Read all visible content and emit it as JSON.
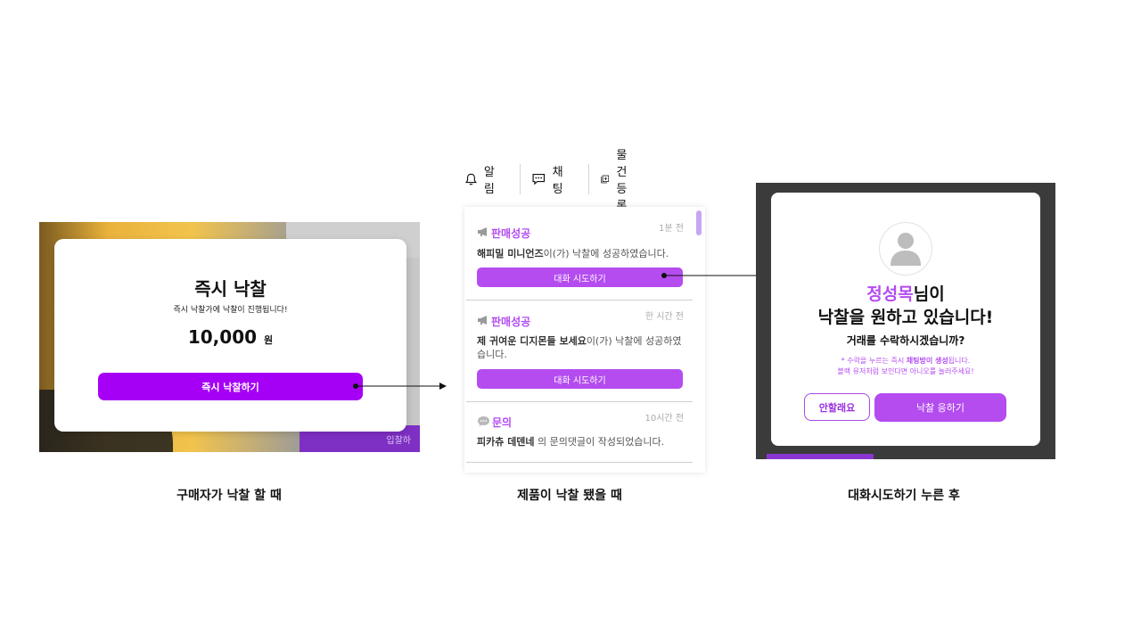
{
  "panel1": {
    "title": "즉시 낙찰",
    "subtitle": "즉시 낙찰가에 낙찰이 진행됩니다!",
    "price": "10,000",
    "price_unit": "원",
    "button_label": "즉시 낙찰하기",
    "bg_fragment": "입찰하"
  },
  "nav": {
    "items": [
      {
        "label": "알림",
        "icon": "bell-icon"
      },
      {
        "label": "채팅",
        "icon": "chat-icon"
      },
      {
        "label": "물건등록",
        "icon": "add-item-icon"
      }
    ]
  },
  "notifications": [
    {
      "category": "판매성공",
      "icon": "megaphone-icon",
      "time": "1분 전",
      "title": "해피밀 미니언즈",
      "text": "이(가) 낙찰에 성공하였습니다.",
      "button_label": "대화 시도하기"
    },
    {
      "category": "판매성공",
      "icon": "megaphone-icon",
      "time": "한 시간 전",
      "title": "제 귀여운 디지몬들 보세요",
      "text": "이(가) 낙찰에 성공하였습니다.",
      "button_label": "대화 시도하기"
    },
    {
      "category": "문의",
      "icon": "speech-bubble-icon",
      "time": "10시간 전",
      "title": "피카츄 데덴네",
      "text": " 의 문의댓글이 작성되었습니다."
    }
  ],
  "panel3": {
    "name": "정성목",
    "name_suffix": "님이",
    "line2": "낙찰을 원하고 있습니다!",
    "line3": "거래를 수락하시겠습니까?",
    "note_prefix": "* 수락을 누르는 즉시 ",
    "note_bold": "채팅방이 생성",
    "note_suffix": "됩니다.",
    "note_line2": "블랙 유저처럼 보인다면 아니오를 눌러주세요!",
    "decline_label": "안할래요",
    "accept_label": "낙찰 응하기"
  },
  "captions": {
    "c1": "구매자가 낙찰 할 때",
    "c2": "제품이 낙찰 됐을 때",
    "c3": "대화시도하기 누른 후"
  },
  "colors": {
    "primary_purple": "#a500f5",
    "accent_purple": "#b44cf0"
  }
}
